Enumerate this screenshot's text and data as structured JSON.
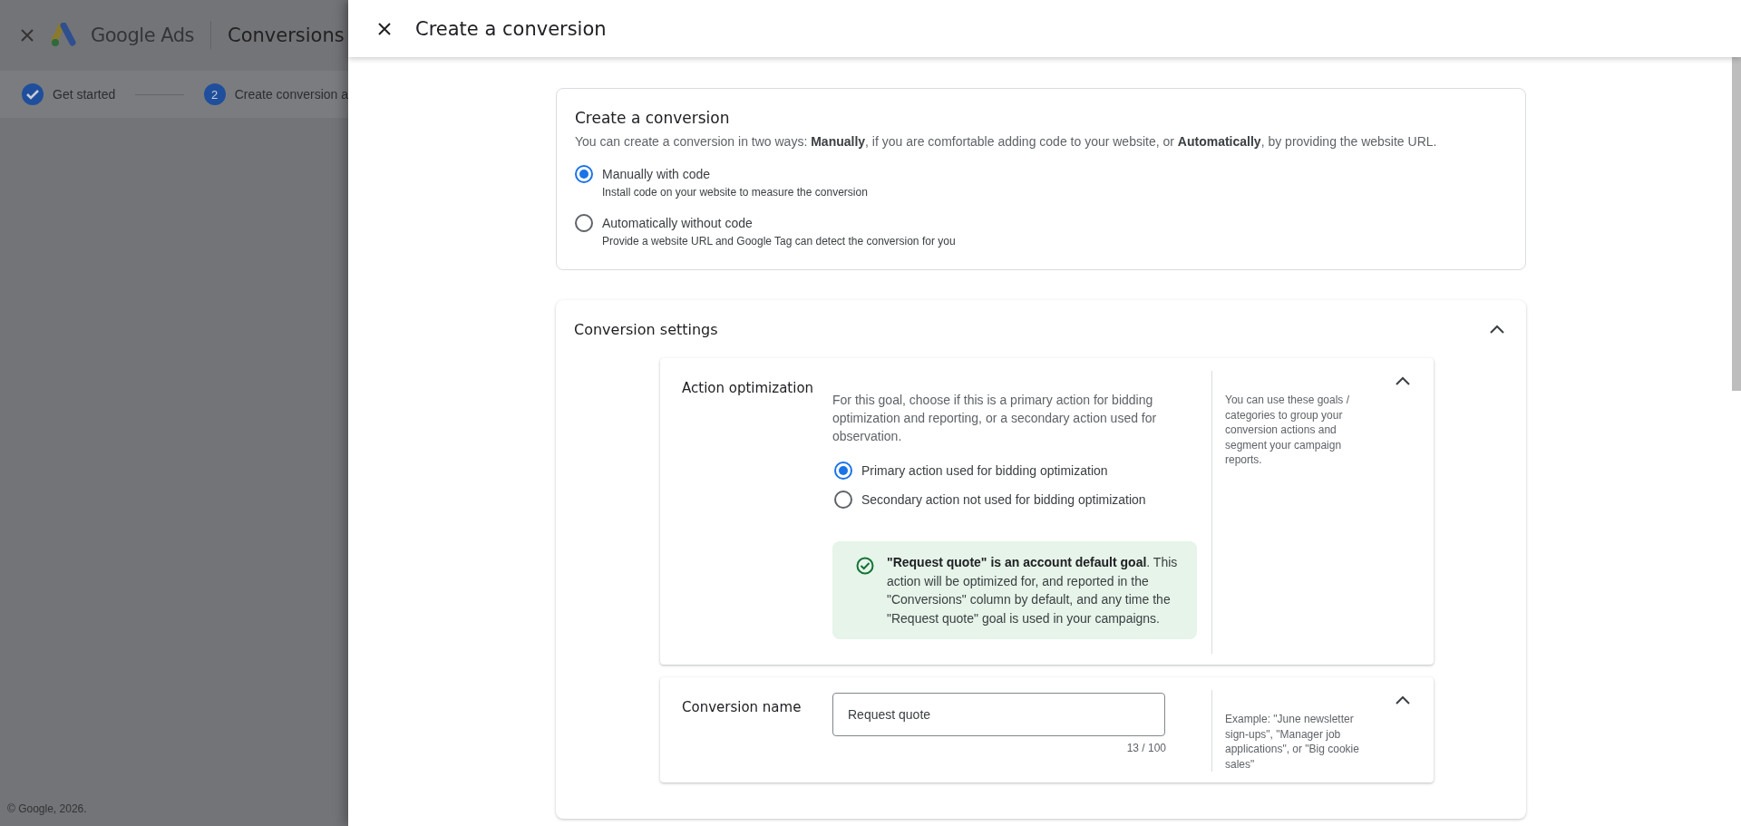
{
  "background_page": {
    "product": "Google Ads",
    "section": "Conversions",
    "steps": [
      {
        "label": "Get started",
        "done": true
      },
      {
        "number": "2",
        "label": "Create conversion a",
        "done": false
      }
    ],
    "footer": "© Google, 2026."
  },
  "panel": {
    "title": "Create a conversion"
  },
  "create_card": {
    "title": "Create a conversion",
    "description": "You can create a conversion in two ways: **Manually**, if you are comfortable adding code to your website, or **Automatically**, by providing the website URL.",
    "options": [
      {
        "label": "Manually with code",
        "description": "Install code on your website to measure the conversion",
        "selected": true
      },
      {
        "label": "Automatically without code",
        "description": "Provide a website URL and Google Tag can detect the conversion for you",
        "selected": false
      }
    ]
  },
  "settings": {
    "title": "Conversion settings",
    "expanded": true,
    "sections": [
      {
        "kind": "radio",
        "label": "Action optimization",
        "expanded": true,
        "description": "For this goal, choose if this is a primary action for bidding optimization and reporting, or a secondary action used for observation.",
        "options": [
          {
            "label": "Primary action used for bidding optimization",
            "selected": true
          },
          {
            "label": "Secondary action not used for bidding optimization",
            "selected": false
          }
        ],
        "notice": "**\"Request quote\" is an account default goal**. This action will be optimized for, and reported in the \"Conversions\" column by default, and any time the \"Request quote\" goal is used in your campaigns.",
        "help": "You can use these goals / categories to group your conversion actions and segment your campaign reports."
      },
      {
        "kind": "text",
        "label": "Conversion name",
        "expanded": true,
        "value": "Request quote",
        "counter": "13 / 100",
        "help": "Example: \"June newsletter sign-ups\", \"Manager job applications\", or \"Big cookie sales\""
      }
    ]
  }
}
